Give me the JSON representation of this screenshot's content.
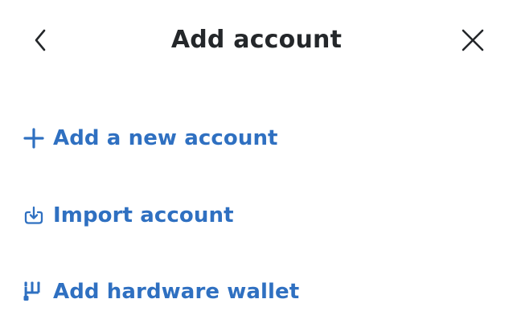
{
  "header": {
    "title": "Add account",
    "back_icon": "chevron-left-icon",
    "close_icon": "close-icon"
  },
  "menu": {
    "items": [
      {
        "label": "Add a new account",
        "icon": "plus-icon"
      },
      {
        "label": "Import account",
        "icon": "import-icon"
      },
      {
        "label": "Add hardware wallet",
        "icon": "hardware-wallet-icon"
      }
    ]
  },
  "colors": {
    "title": "#24272a",
    "accent": "#2f70c1",
    "background": "#ffffff"
  }
}
